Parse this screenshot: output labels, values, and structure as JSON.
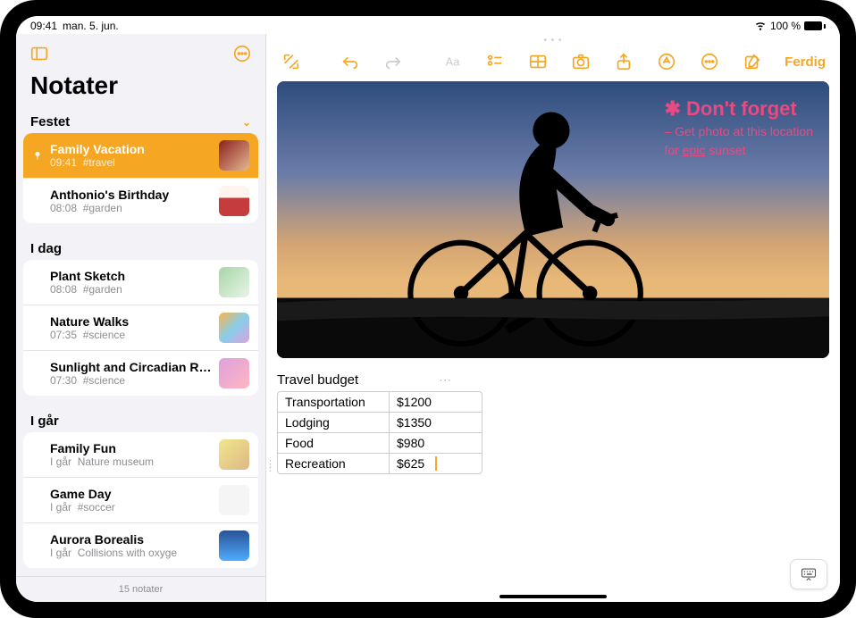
{
  "status": {
    "time": "09:41",
    "date": "man. 5. jun.",
    "battery": "100 %"
  },
  "sidebar": {
    "title": "Notater",
    "sections": [
      {
        "label": "Festet",
        "items": [
          {
            "title": "Family Vacation",
            "time": "09:41",
            "tag": "#travel",
            "selected": true,
            "pinned": true
          },
          {
            "title": "Anthonio's Birthday",
            "time": "08:08",
            "tag": "#garden"
          }
        ]
      },
      {
        "label": "I dag",
        "items": [
          {
            "title": "Plant Sketch",
            "time": "08:08",
            "tag": "#garden"
          },
          {
            "title": "Nature Walks",
            "time": "07:35",
            "tag": "#science"
          },
          {
            "title": "Sunlight and Circadian Rhy…",
            "time": "07:30",
            "tag": "#science"
          }
        ]
      },
      {
        "label": "I går",
        "items": [
          {
            "title": "Family Fun",
            "time": "I går",
            "tag": "Nature museum"
          },
          {
            "title": "Game Day",
            "time": "I går",
            "tag": "#soccer"
          },
          {
            "title": "Aurora Borealis",
            "time": "I går",
            "tag": "Collisions with oxyge"
          }
        ]
      }
    ],
    "footer": "15 notater"
  },
  "toolbar": {
    "done": "Ferdig"
  },
  "note": {
    "handwriting_title": "✱ Don't forget",
    "handwriting_sub1": "– Get photo at this location",
    "handwriting_sub2_pre": "for ",
    "handwriting_sub2_em": "epic",
    "handwriting_sub2_post": " sunset",
    "table_title": "Travel budget",
    "rows": [
      {
        "label": "Transportation",
        "value": "$1200"
      },
      {
        "label": "Lodging",
        "value": "$1350"
      },
      {
        "label": "Food",
        "value": "$980"
      },
      {
        "label": "Recreation",
        "value": "$625"
      }
    ]
  }
}
